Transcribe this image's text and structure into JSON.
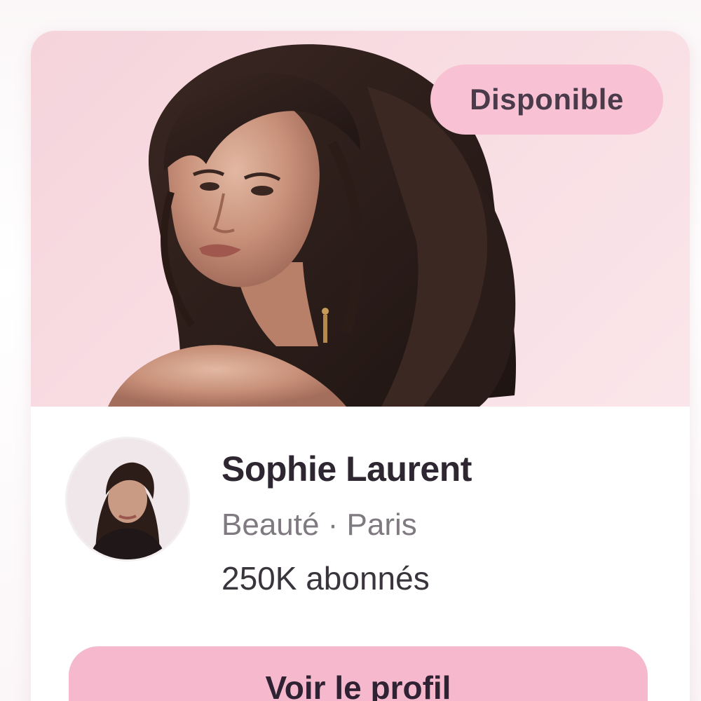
{
  "card": {
    "status_badge": "Disponible",
    "name": "Sophie Laurent",
    "category": "Beauté · Paris",
    "followers": "250K abonnés",
    "cta_label": "Voir le profil"
  },
  "colors": {
    "hero_background": "#f6d4dc",
    "badge_background": "#f8c2d4",
    "button_background": "#f6b8cd",
    "text_dark": "#2e2630",
    "text_muted": "#7e7a80"
  }
}
